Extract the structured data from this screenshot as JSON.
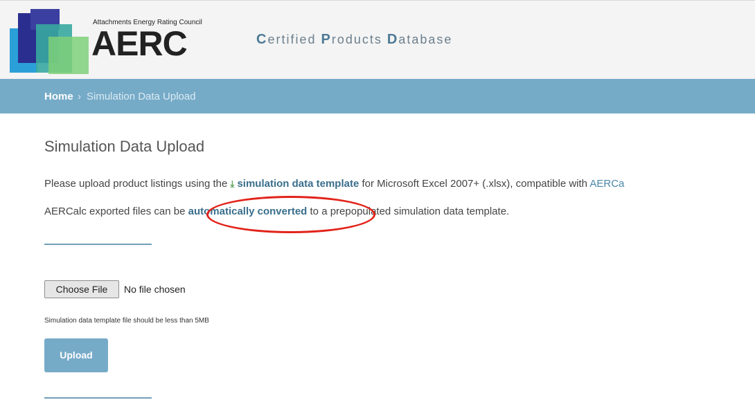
{
  "header": {
    "logo_small": "Attachments Energy Rating Council",
    "logo_big": "AERC",
    "title_parts": [
      {
        "cap": "C",
        "rest": "ertified "
      },
      {
        "cap": "P",
        "rest": "roducts "
      },
      {
        "cap": "D",
        "rest": "atabase"
      }
    ]
  },
  "breadcrumb": {
    "home": "Home",
    "separator": "›",
    "current": "Simulation Data Upload"
  },
  "main": {
    "heading": "Simulation Data Upload",
    "line1_prefix": "Please upload product listings using the ",
    "template_link": "simulation data template",
    "line1_mid": " for Microsoft Excel 2007+ (.xlsx), compatible with ",
    "line1_link_tail": "AERCa",
    "line2_prefix": "AERCalc exported files can be ",
    "convert_link": "automatically converted",
    "line2_suffix": " to a prepopulated simulation data template.",
    "choose_file_label": "Choose File",
    "file_status": "No file chosen",
    "hint": "Simulation data template file should be less than 5MB",
    "upload_label": "Upload"
  },
  "colors": {
    "breadcrumb_bg": "#76abc8",
    "link": "#3a6e8c",
    "highlight_circle": "#e2231a"
  }
}
